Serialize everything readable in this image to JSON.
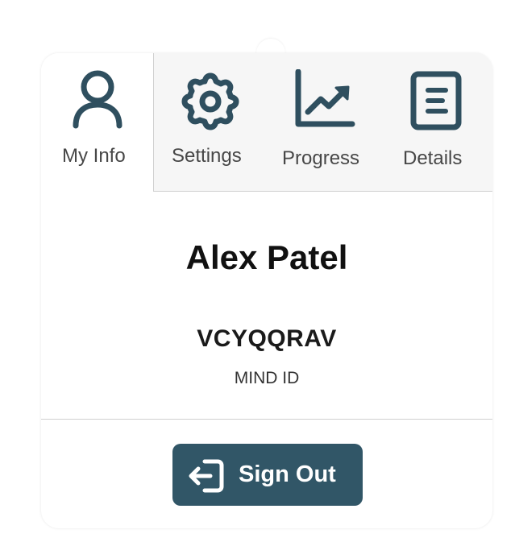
{
  "tabs": [
    {
      "label": "My Info",
      "icon": "user-icon",
      "active": true
    },
    {
      "label": "Settings",
      "icon": "gear-icon",
      "active": false
    },
    {
      "label": "Progress",
      "icon": "chart-trend-icon",
      "active": false
    },
    {
      "label": "Details",
      "icon": "document-icon",
      "active": false
    }
  ],
  "profile": {
    "name": "Alex Patel",
    "mind_id": "VCYQQRAV",
    "mind_id_label": "MIND ID"
  },
  "actions": {
    "sign_out_label": "Sign Out",
    "sign_out_icon": "sign-out-icon"
  },
  "colors": {
    "accent": "#315667",
    "icon": "#2f4f5f",
    "inactive_tab_bg": "#f6f6f6"
  }
}
